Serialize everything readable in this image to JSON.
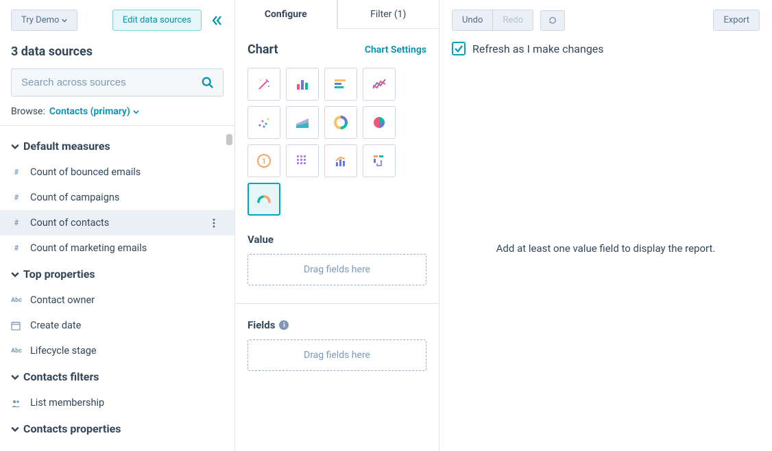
{
  "left": {
    "try_demo": "Try Demo",
    "edit_sources": "Edit data sources",
    "title": "3 data sources",
    "search_placeholder": "Search across sources",
    "browse_label": "Browse:",
    "browse_value": "Contacts (primary)",
    "sections": {
      "default_measures": {
        "title": "Default measures",
        "items": [
          "Count of bounced emails",
          "Count of campaigns",
          "Count of contacts",
          "Count of marketing emails"
        ]
      },
      "top_properties": {
        "title": "Top properties",
        "items": [
          "Contact owner",
          "Create date",
          "Lifecycle stage"
        ]
      },
      "contacts_filters": {
        "title": "Contacts filters",
        "items": [
          "List membership"
        ]
      },
      "contacts_properties": {
        "title": "Contacts properties"
      }
    }
  },
  "mid": {
    "tabs": {
      "configure": "Configure",
      "filter": "Filter (1)"
    },
    "chart_title": "Chart",
    "chart_settings": "Chart Settings",
    "value_label": "Value",
    "fields_label": "Fields",
    "drag_hint": "Drag fields here"
  },
  "right": {
    "undo": "Undo",
    "redo": "Redo",
    "export": "Export",
    "refresh_label": "Refresh as I make changes",
    "empty": "Add at least one value field to display the report."
  }
}
